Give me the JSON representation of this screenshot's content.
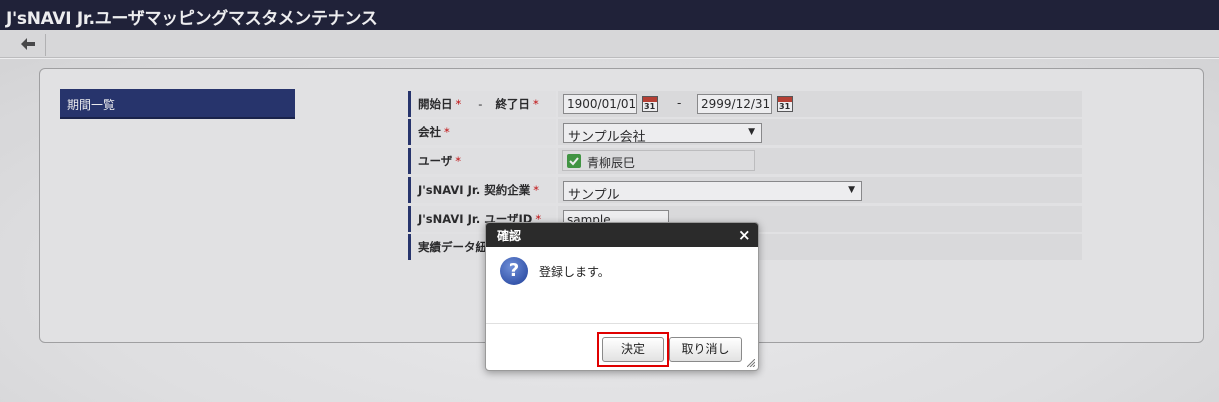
{
  "app": {
    "title": "J'sNAVI Jr.ユーザマッピングマスタメンテナンス"
  },
  "toolbar": {
    "back_icon": "arrow-left-icon"
  },
  "period_list": {
    "label": "期間一覧"
  },
  "form": {
    "period": {
      "start_label": "開始日",
      "dash": "-",
      "end_label": "終了日",
      "start_value": "1900/01/01",
      "end_value": "2999/12/31",
      "calendar_text": "31"
    },
    "company": {
      "label": "会社",
      "value": "サンプル会社"
    },
    "user": {
      "label": "ユーザ",
      "value": "青柳辰巳"
    },
    "contract_company": {
      "label": "J'sNAVI Jr. 契約企業",
      "value": "サンプル"
    },
    "user_id": {
      "label": "J'sNAVI Jr. ユーザID",
      "value": "sample"
    },
    "performance": {
      "label": "実績データ紐付"
    },
    "required_mark": "*"
  },
  "dialog": {
    "title": "確認",
    "close": "×",
    "icon": "question-icon",
    "icon_glyph": "?",
    "message": "登録します。",
    "ok_label": "決定",
    "cancel_label": "取り消し"
  },
  "colors": {
    "header": "#161830",
    "accent": "#1e2d6a",
    "required": "#cc0000",
    "highlight": "#e00000"
  }
}
